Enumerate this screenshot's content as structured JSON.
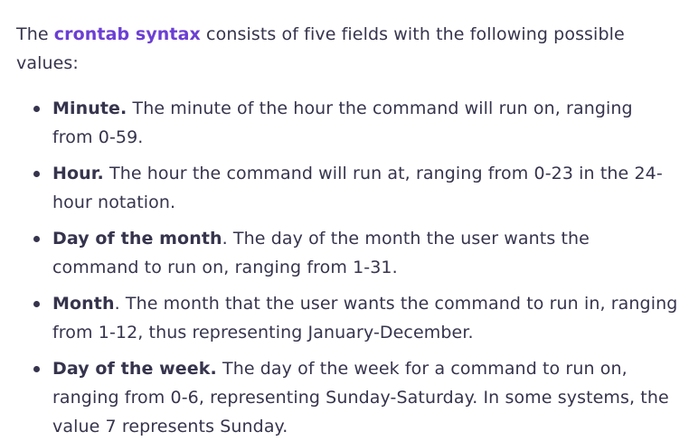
{
  "intro": {
    "before": "The ",
    "link": "crontab syntax",
    "after": " consists of five fields with the following possible values:"
  },
  "fields": [
    {
      "term": "Minute.",
      "description": " The minute of the hour the command will run on, ranging from 0-59."
    },
    {
      "term": "Hour.",
      "description": " The hour the command will run at, ranging from 0-23 in the 24-hour notation."
    },
    {
      "term": "Day of the month",
      "description": ". The day of the month the user wants the command to run on, ranging from 1-31."
    },
    {
      "term": "Month",
      "description": ". The month that the user wants the command to run in, ranging from 1-12, thus representing January-December."
    },
    {
      "term": "Day of the week.",
      "description": " The day of the week for a command to run on, ranging from 0-6, representing Sunday-Saturday. In some systems, the value 7 represents Sunday."
    }
  ]
}
